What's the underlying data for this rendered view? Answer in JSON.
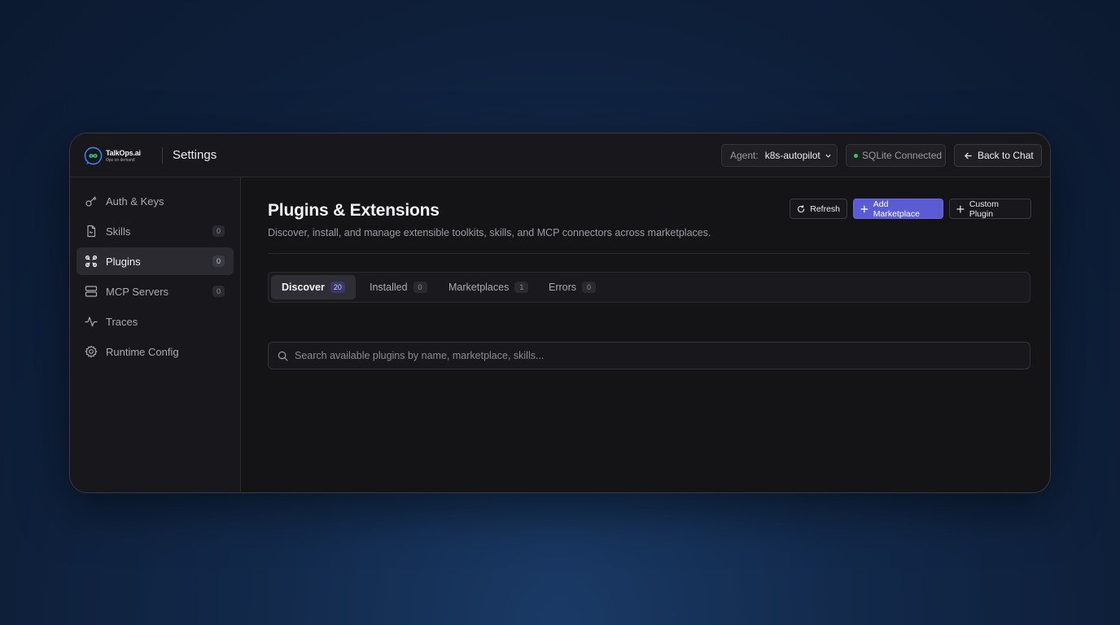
{
  "brand": {
    "name": "TalkOps.ai",
    "tagline": "Ops on demand"
  },
  "header": {
    "title": "Settings",
    "agent_label": "Agent:",
    "agent_value": "k8s-autopilot",
    "status_text": "SQLite Connected",
    "back_label": "Back to Chat"
  },
  "sidebar": {
    "items": [
      {
        "label": "Auth & Keys",
        "icon": "key-icon"
      },
      {
        "label": "Skills",
        "icon": "file-icon",
        "count": "0"
      },
      {
        "label": "Plugins",
        "icon": "puzzle-icon",
        "count": "0",
        "active": true
      },
      {
        "label": "MCP Servers",
        "icon": "server-icon",
        "count": "0"
      },
      {
        "label": "Traces",
        "icon": "activity-icon"
      },
      {
        "label": "Runtime Config",
        "icon": "gear-icon"
      }
    ]
  },
  "main": {
    "title": "Plugins & Extensions",
    "subtitle": "Discover, install, and manage extensible toolkits, skills, and MCP connectors across marketplaces.",
    "buttons": {
      "refresh": "Refresh",
      "add_marketplace": "Add Marketplace",
      "custom_plugin": "Custom Plugin"
    },
    "tabs": [
      {
        "label": "Discover",
        "count": "20",
        "active": true
      },
      {
        "label": "Installed",
        "count": "0"
      },
      {
        "label": "Marketplaces",
        "count": "1"
      },
      {
        "label": "Errors",
        "count": "0"
      }
    ],
    "search": {
      "placeholder": "Search available plugins by name, marketplace, skills...",
      "value": ""
    }
  },
  "colors": {
    "accent": "#5b5bd6",
    "status_ok": "#34c759",
    "window_bg": "#141417"
  }
}
